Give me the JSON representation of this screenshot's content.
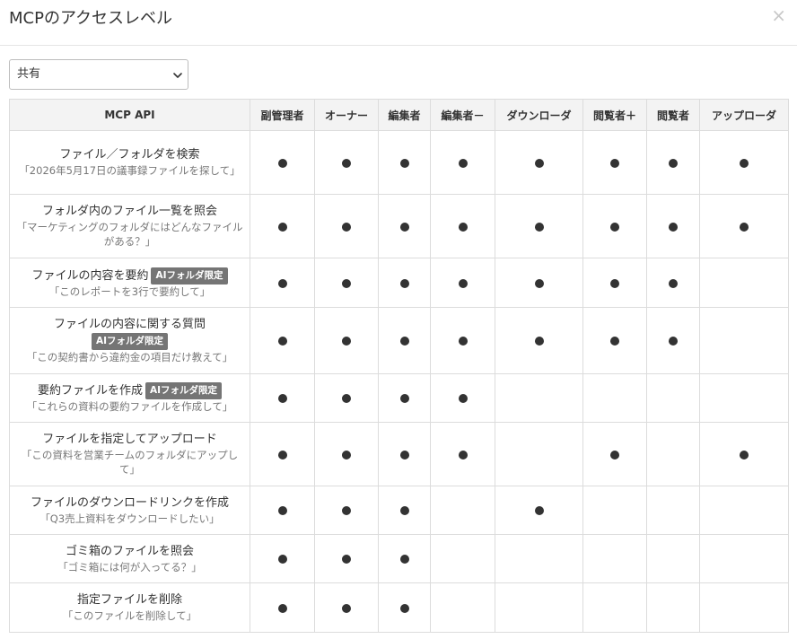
{
  "dialog": {
    "title": "MCPのアクセスレベル",
    "close_label": "×"
  },
  "select": {
    "value": "共有",
    "icon": "chevron-down-icon"
  },
  "table": {
    "headers": [
      "MCP API",
      "副管理者",
      "オーナー",
      "編集者",
      "編集者－",
      "ダウンローダ",
      "閲覧者＋",
      "閲覧者",
      "アップローダ"
    ],
    "rows": [
      {
        "name": "ファイル／フォルダを検索",
        "badge": "",
        "example": "「2026年5月17日の議事録ファイルを探して」",
        "access": [
          true,
          true,
          true,
          true,
          true,
          true,
          true,
          true
        ]
      },
      {
        "name": "フォルダ内のファイル一覧を照会",
        "badge": "",
        "example": "「マーケティングのフォルダにはどんなファイルがある？」",
        "access": [
          true,
          true,
          true,
          true,
          true,
          true,
          true,
          true
        ]
      },
      {
        "name": "ファイルの内容を要約",
        "badge": "AIフォルダ限定",
        "example": "「このレポートを3行で要約して」",
        "access": [
          true,
          true,
          true,
          true,
          true,
          true,
          true,
          false
        ]
      },
      {
        "name": "ファイルの内容に関する質問",
        "badge": "AIフォルダ限定",
        "badge_block": true,
        "example": "「この契約書から違約金の項目だけ教えて」",
        "access": [
          true,
          true,
          true,
          true,
          true,
          true,
          true,
          false
        ]
      },
      {
        "name": "要約ファイルを作成",
        "badge": "AIフォルダ限定",
        "example": "「これらの資料の要約ファイルを作成して」",
        "access": [
          true,
          true,
          true,
          true,
          false,
          false,
          false,
          false
        ]
      },
      {
        "name": "ファイルを指定してアップロード",
        "badge": "",
        "example": "「この資料を営業チームのフォルダにアップして」",
        "access": [
          true,
          true,
          true,
          true,
          false,
          true,
          false,
          true
        ]
      },
      {
        "name": "ファイルのダウンロードリンクを作成",
        "badge": "",
        "example": "「Q3売上資料をダウンロードしたい」",
        "access": [
          true,
          true,
          true,
          false,
          true,
          false,
          false,
          false
        ]
      },
      {
        "name": "ゴミ箱のファイルを照会",
        "badge": "",
        "example": "「ゴミ箱には何が入ってる？」",
        "access": [
          true,
          true,
          true,
          false,
          false,
          false,
          false,
          false
        ]
      },
      {
        "name": "指定ファイルを削除",
        "badge": "",
        "example": "「このファイルを削除して」",
        "access": [
          true,
          true,
          true,
          false,
          false,
          false,
          false,
          false
        ]
      }
    ]
  }
}
